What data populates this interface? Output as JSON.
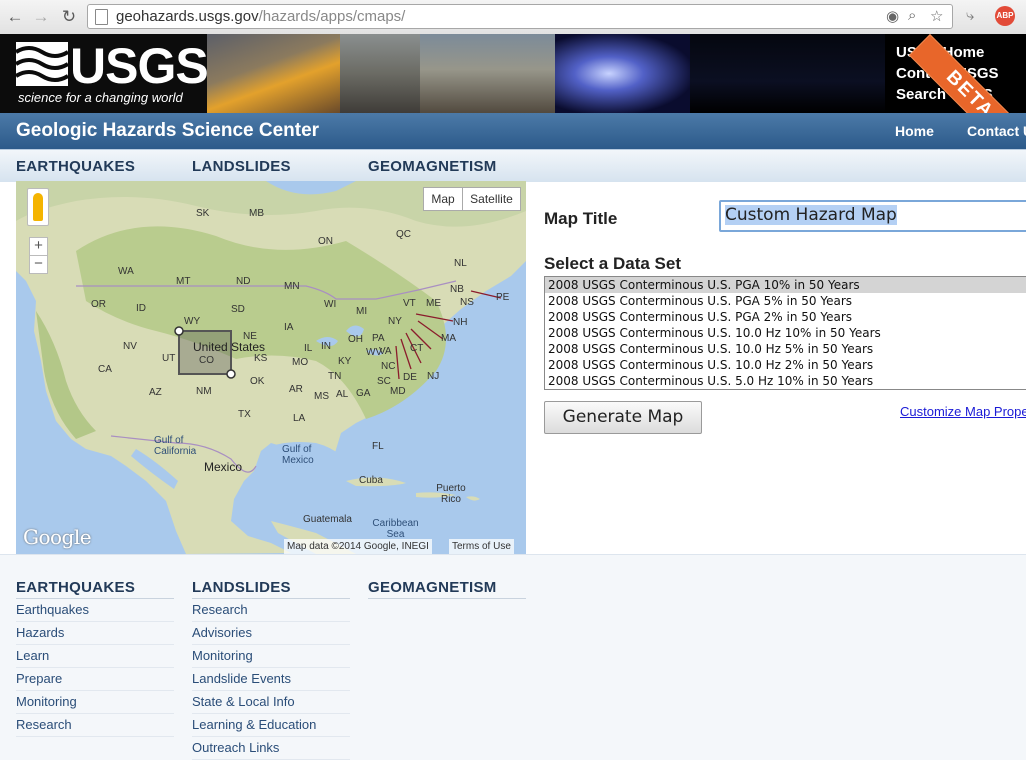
{
  "browser": {
    "url_host": "geohazards.usgs.gov",
    "url_path": "/hazards/apps/cmaps/"
  },
  "banner": {
    "logo_text": "USGS",
    "tagline": "science for a changing world",
    "links": [
      "USGS Home",
      "Contact USGS",
      "Search USGS"
    ],
    "beta_label": "BETA"
  },
  "header": {
    "site_title": "Geologic Hazards Science Center",
    "home_link": "Home",
    "contact_link": "Contact Us"
  },
  "nav": {
    "tabs": [
      "EARTHQUAKES",
      "LANDSLIDES",
      "GEOMAGNETISM"
    ]
  },
  "map": {
    "type_map": "Map",
    "type_satellite": "Satellite",
    "google_logo": "Google",
    "attribution": "Map data ©2014 Google, INEGI",
    "terms": "Terms of Use",
    "labels": {
      "united_states": "United States",
      "mexico": "Mexico",
      "gulf_of_california": "Gulf of California",
      "gulf_of_mexico": "Gulf of Mexico",
      "cuba": "Cuba",
      "puerto_rico": "Puerto Rico",
      "guatemala": "Guatemala",
      "caribbean_sea": "Caribbean Sea",
      "states": [
        "SK",
        "MB",
        "ON",
        "QC",
        "NL",
        "NB",
        "PE",
        "NS",
        "WA",
        "MT",
        "ND",
        "MN",
        "WI",
        "MI",
        "NY",
        "VT",
        "ME",
        "NH",
        "MA",
        "CT",
        "NJ",
        "DE",
        "MD",
        "PA",
        "OH",
        "IN",
        "IL",
        "IA",
        "NE",
        "SD",
        "WY",
        "ID",
        "OR",
        "NV",
        "UT",
        "CO",
        "CA",
        "AZ",
        "NM",
        "TX",
        "OK",
        "KS",
        "MO",
        "AR",
        "LA",
        "MS",
        "AL",
        "GA",
        "SC",
        "NC",
        "TN",
        "KY",
        "VA",
        "WV",
        "FL"
      ]
    }
  },
  "form": {
    "map_title_label": "Map Title",
    "map_title_value": "Custom Hazard Map",
    "dataset_label": "Select a Data Set",
    "datasets": [
      "2008 USGS Conterminous U.S. PGA 10% in 50 Years",
      "2008 USGS Conterminous U.S. PGA 5% in 50 Years",
      "2008 USGS Conterminous U.S. PGA 2% in 50 Years",
      "2008 USGS Conterminous U.S. 10.0 Hz 10% in 50 Years",
      "2008 USGS Conterminous U.S. 10.0 Hz 5% in 50 Years",
      "2008 USGS Conterminous U.S. 10.0 Hz 2% in 50 Years",
      "2008 USGS Conterminous U.S. 5.0 Hz 10% in 50 Years"
    ],
    "selected_index": 0,
    "generate_button": "Generate Map",
    "customize_link": "Customize Map Properties"
  },
  "footer": {
    "columns": [
      {
        "heading": "EARTHQUAKES",
        "items": [
          "Earthquakes",
          "Hazards",
          "Learn",
          "Prepare",
          "Monitoring",
          "Research"
        ]
      },
      {
        "heading": "LANDSLIDES",
        "items": [
          "Research",
          "Advisories",
          "Monitoring",
          "Landslide Events",
          "State & Local Info",
          "Learning & Education",
          "Outreach Links"
        ]
      },
      {
        "heading": "GEOMAGNETISM",
        "items": []
      }
    ]
  },
  "colors": {
    "header_blue": "#2c5a8a",
    "nav_text": "#223a58",
    "link_blue": "#1a1ad6",
    "beta_orange": "#e8662a"
  }
}
